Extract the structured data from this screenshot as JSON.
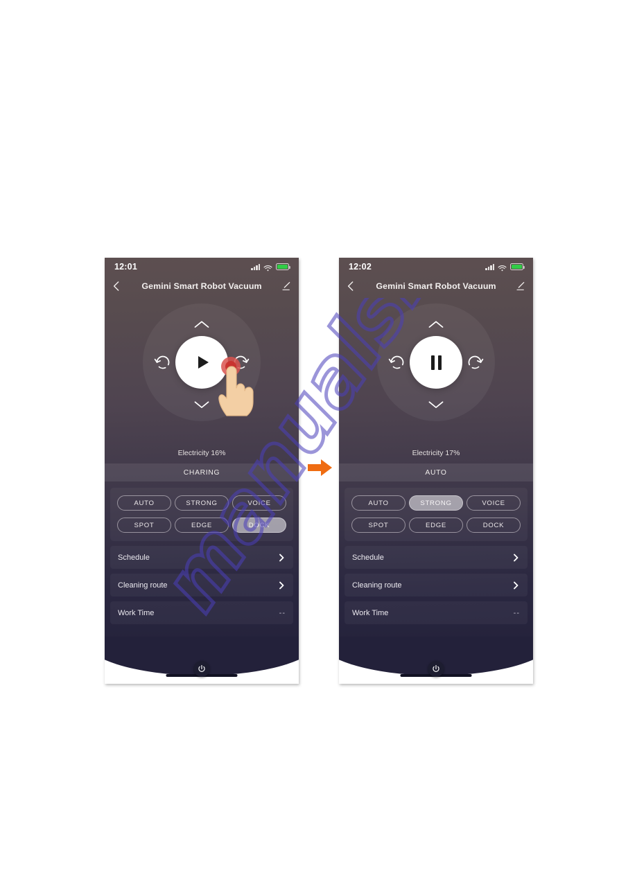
{
  "colors": {
    "arrow": "#ef6c12",
    "battery": "#31cc46",
    "watermark": "#4b3fbb",
    "pill_active_bg": "#e1dee4",
    "page_bg": "#ffffff"
  },
  "watermark": {
    "text": "manualshive.com"
  },
  "flow": {
    "arrow_icon": "arrow-right-icon"
  },
  "phones": [
    {
      "id": "before",
      "status": {
        "time": "12:01",
        "signal_icon": "cellular-signal-icon",
        "wifi_icon": "wifi-icon",
        "battery_icon": "battery-charging-icon"
      },
      "nav": {
        "back_icon": "chevron-left-icon",
        "title": "Gemini Smart Robot Vacuum",
        "edit_icon": "pencil-icon"
      },
      "control": {
        "up_icon": "chevron-up-icon",
        "down_icon": "chevron-down-icon",
        "rotate_left_icon": "rotate-left-icon",
        "rotate_right_icon": "rotate-right-icon",
        "center_icon": "play-icon",
        "center_state": "play",
        "tap_indicator": "finger-tap-icon"
      },
      "electricity": "Electricity 16%",
      "mode_status": "CHARING",
      "pills": [
        {
          "label": "AUTO",
          "active": false
        },
        {
          "label": "STRONG",
          "active": false
        },
        {
          "label": "VOICE",
          "active": false
        },
        {
          "label": "SPOT",
          "active": false
        },
        {
          "label": "EDGE",
          "active": false
        },
        {
          "label": "DOCK",
          "active": true
        }
      ],
      "rows": [
        {
          "label": "Schedule",
          "value": "",
          "chevron": true
        },
        {
          "label": "Cleaning route",
          "value": "",
          "chevron": true
        },
        {
          "label": "Work Time",
          "value": "--",
          "chevron": false
        }
      ],
      "home": {
        "power_icon": "power-icon",
        "home_bar": "home-indicator"
      }
    },
    {
      "id": "after",
      "status": {
        "time": "12:02",
        "signal_icon": "cellular-signal-icon",
        "wifi_icon": "wifi-icon",
        "battery_icon": "battery-charging-icon"
      },
      "nav": {
        "back_icon": "chevron-left-icon",
        "title": "Gemini Smart Robot Vacuum",
        "edit_icon": "pencil-icon"
      },
      "control": {
        "up_icon": "chevron-up-icon",
        "down_icon": "chevron-down-icon",
        "rotate_left_icon": "rotate-left-icon",
        "rotate_right_icon": "rotate-right-icon",
        "center_icon": "pause-icon",
        "center_state": "pause",
        "tap_indicator": ""
      },
      "electricity": "Electricity 17%",
      "mode_status": "AUTO",
      "pills": [
        {
          "label": "AUTO",
          "active": false
        },
        {
          "label": "STRONG",
          "active": true
        },
        {
          "label": "VOICE",
          "active": false
        },
        {
          "label": "SPOT",
          "active": false
        },
        {
          "label": "EDGE",
          "active": false
        },
        {
          "label": "DOCK",
          "active": false
        }
      ],
      "rows": [
        {
          "label": "Schedule",
          "value": "",
          "chevron": true
        },
        {
          "label": "Cleaning route",
          "value": "",
          "chevron": true
        },
        {
          "label": "Work Time",
          "value": "--",
          "chevron": false
        }
      ],
      "home": {
        "power_icon": "power-icon",
        "home_bar": "home-indicator"
      }
    }
  ]
}
